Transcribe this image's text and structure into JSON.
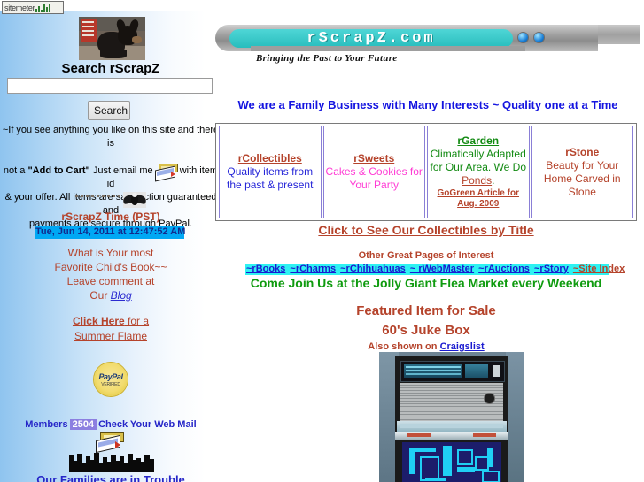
{
  "sidebar": {
    "sitemeter_label": "sitemeter",
    "dog_photo_alt": "chihuahua-photo",
    "search_title": "Search rScrapZ",
    "search_value": "",
    "search_placeholder": "",
    "search_button": "Search",
    "blurb_line1": "~If you see anything you like on this site and there is",
    "blurb_line2_a": "not a ",
    "blurb_line2_b": "\"Add to Cart\"",
    "blurb_line2_c": " Just email me",
    "blurb_line2_d": "with item id",
    "blurb_line3": "& your offer. All items are satisfaction guaranteed and",
    "blurb_line4": "payments are secure through PayPal.",
    "time_label": "rScrapZ Time (PST)",
    "time_value": "Tue, Jun 14, 2011 at 12:47:52 AM",
    "blog_line1": "What is Your most",
    "blog_line2": "Favorite Child's Book~~",
    "blog_line3": "Leave comment at",
    "blog_line4_prefix": "Our ",
    "blog_link": "Blog",
    "summer_line1_a": "Click Here",
    "summer_line1_b": " for a",
    "summer_line2": "Summer Flame",
    "paypal_word": "PayPal",
    "paypal_sub": "VERIFIED",
    "members_label": "Members",
    "members_count": "2504",
    "members_suffix": "Check Your Web Mail",
    "families_text": "Our Families are in Trouble"
  },
  "banner": {
    "title": "rScrapZ.com",
    "slogan": "Bringing the Past to Your Future",
    "tagline": "We are a Family Business with Many Interests ~ Quality one at a Time"
  },
  "categories": [
    {
      "name": "rCollectibles",
      "desc": "Quality items from the past & present",
      "extra": ""
    },
    {
      "name": "rSweets",
      "desc": "Cakes & Cookies for Your Party",
      "extra": ""
    },
    {
      "name": "rGarden",
      "desc_a": "Climatically Adapted for Our Area. We Do ",
      "desc_link": "Ponds",
      "desc_b": ".",
      "extra": "GoGreen Article for Aug. 2009"
    },
    {
      "name": "rStone",
      "desc": "Beauty for Your Home Carved in Stone",
      "extra": ""
    }
  ],
  "main": {
    "see_collectibles": "Click to See Our Collectibles by Title",
    "other_pages_heading": "Other Great Pages of Interest",
    "nav_links": [
      "~rBooks",
      "~rCharms",
      "~rChihuahuas",
      "~ rWebMaster",
      "~rAuctions",
      "~rStory",
      "~Site Index"
    ],
    "join_us": "Come Join Us at the Jolly Giant Flea Market every Weekend",
    "featured_title": "Featured Item for Sale",
    "featured_item": "60's Juke Box",
    "also_shown_prefix": "Also shown on ",
    "also_shown_link": "Craigslist"
  },
  "colors": {
    "heading_brown": "#b5432b",
    "link_blue": "#1a1ad0",
    "green": "#0f9b0f",
    "pink": "#ff3ad4",
    "cyan_highlight": "#2ef2f2",
    "banner_teal": "#28bdbd",
    "tagline_blue": "#1414e0",
    "time_bg": "#00a8f4",
    "members_badge": "#8c7fe0"
  }
}
